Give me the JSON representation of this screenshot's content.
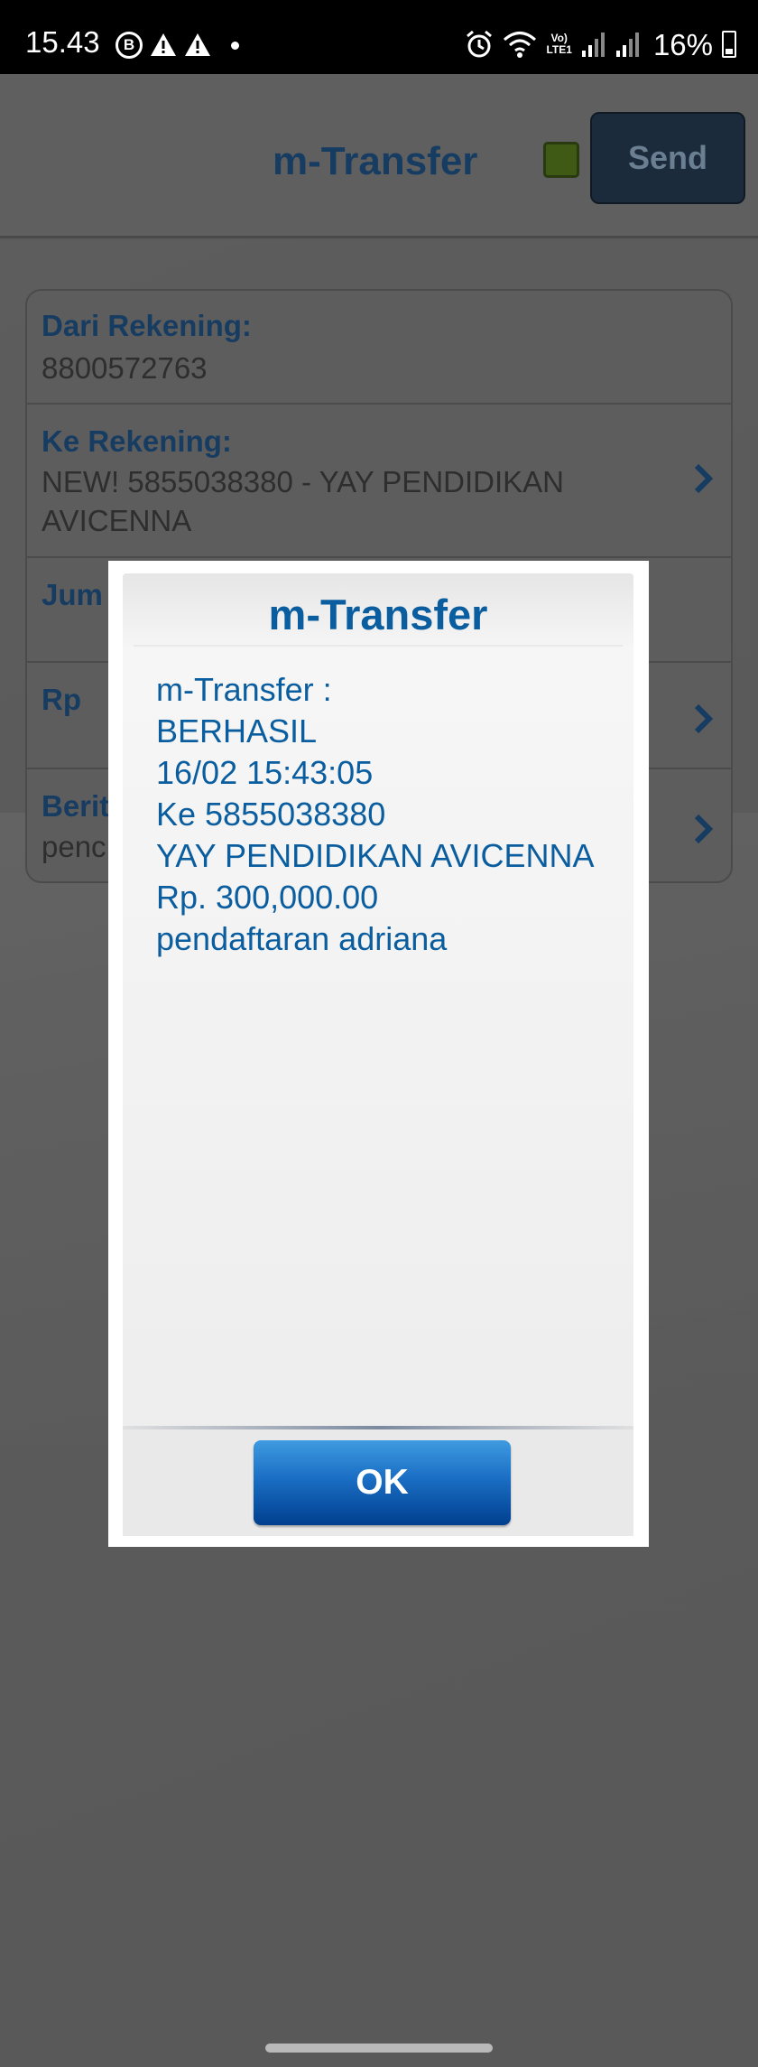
{
  "status_bar": {
    "time": "15.43",
    "badge_letter": "B",
    "lte_label_top": "Vo)",
    "lte_label_bottom": "LTE1",
    "battery": "16%"
  },
  "header": {
    "title": "m-Transfer",
    "send_label": "Send",
    "status_color": "#3f5a14"
  },
  "form": {
    "from_label": "Dari Rekening:",
    "from_value": "8800572763",
    "to_label": "Ke Rekening:",
    "to_value_line1": "NEW! 5855038380 - YAY PENDIDIKAN",
    "to_value_line2": "AVICENNA",
    "amount_label_partial": "Jum",
    "currency_label": "Rp",
    "note_label_partial": "Berit",
    "note_value_partial": "penc"
  },
  "dialog": {
    "title": "m-Transfer",
    "lines": [
      "m-Transfer :",
      "BERHASIL",
      "16/02 15:43:05",
      "Ke 5855038380",
      "YAY PENDIDIKAN AVICENNA",
      "Rp. 300,000.00",
      "pendaftaran adriana"
    ],
    "ok_label": "OK"
  },
  "colors": {
    "accent": "#0a5d9e",
    "button_dark": "#003f8f"
  }
}
